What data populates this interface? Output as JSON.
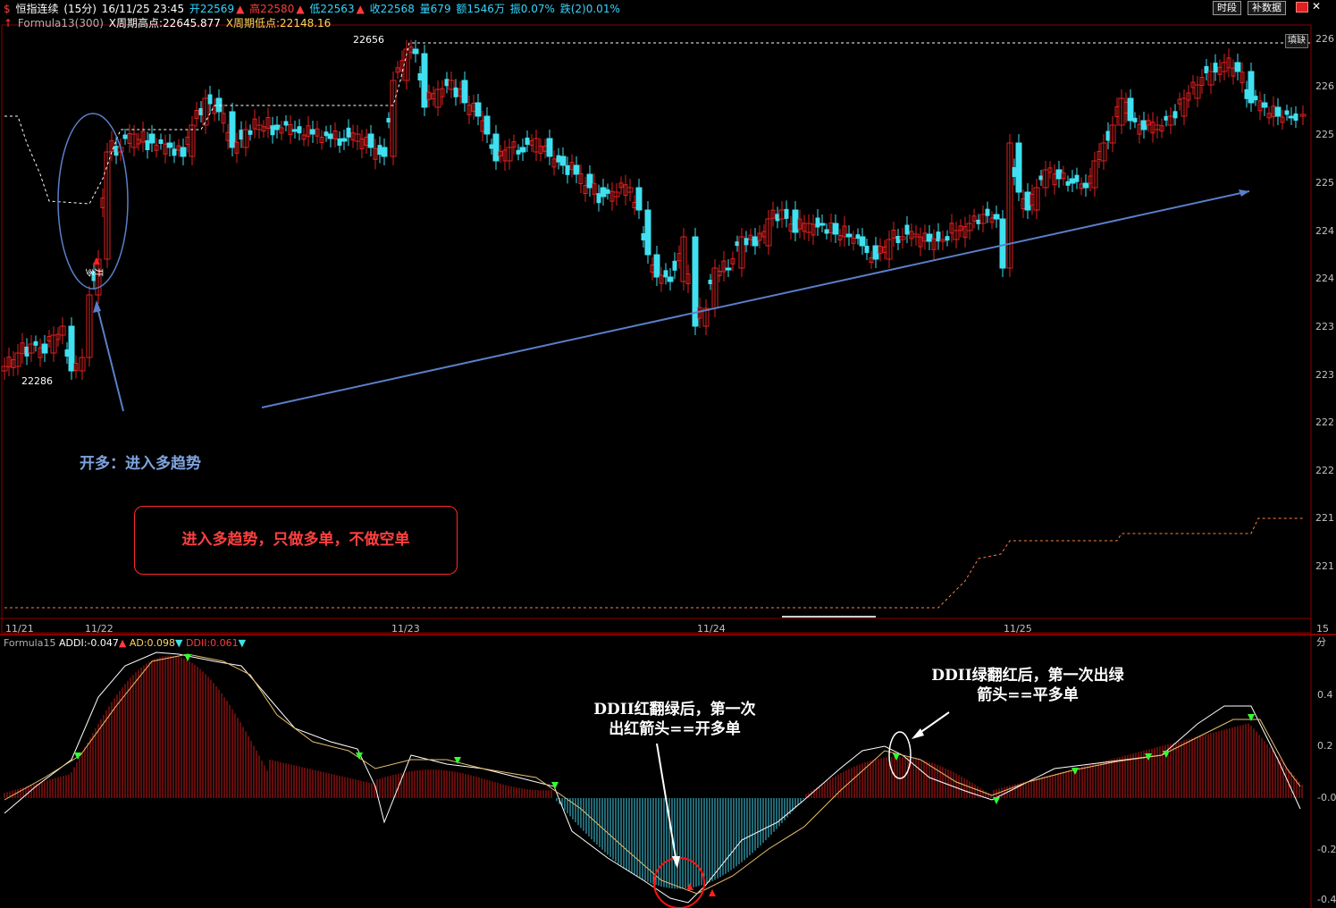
{
  "header": {
    "symbol_name": "恒指连续",
    "period": "(15分)",
    "datetime": "16/11/25 23:45",
    "open": "开22569",
    "high": "高22580",
    "low": "低22563",
    "close": "收22568",
    "volume": "量679",
    "amount": "额1546万",
    "amplitude": "振0.07%",
    "change": "跌(2)0.01%"
  },
  "formula_header": {
    "name": "Formula13(300)",
    "high_label": "X周期高点:22645.877",
    "low_label": "X周期低点:22148.16"
  },
  "toolbar": {
    "time_segment": "时段",
    "supplement_data": "补数据",
    "fill_gap": "填缺"
  },
  "price_markers": {
    "high_value": "22656",
    "low_value": "22286",
    "open_long_tag": "开多"
  },
  "price_axis_labels": [
    "226",
    "226",
    "225",
    "225",
    "224",
    "224",
    "223",
    "223",
    "222",
    "222",
    "221",
    "221",
    "221"
  ],
  "date_labels": [
    "11/21",
    "11/22",
    "11/23",
    "11/24",
    "11/25"
  ],
  "period_tag": "15分",
  "notes": {
    "open_long": "开多：进入多趋势",
    "trend_rule": "进入多趋势，只做多单，不做空单",
    "annotation_red_to_green": [
      "DDII红翻绿后，第一次",
      "出红箭头==开多单"
    ],
    "annotation_green_to_red": [
      "DDII绿翻红后，第一次出绿",
      "箭头==平多单"
    ]
  },
  "indicator": {
    "name": "Formula15",
    "addi": "ADDI:-0.047",
    "ad": "AD:0.098",
    "ddii": "DDII:0.061",
    "axis_labels": [
      "0.4",
      "0.2",
      "-0.0",
      "-0.2",
      "-0.4"
    ]
  },
  "colors": {
    "up": "#e02020",
    "down": "#40e0f0",
    "background": "#000000",
    "trendline": "#5a7fc8",
    "hist_up": "#c81818",
    "hist_down": "#40d0e8",
    "line_white": "#ffffff",
    "line_yellow": "#e8c070",
    "signal": "#30ff30",
    "stop_line": "#ff8040"
  }
}
